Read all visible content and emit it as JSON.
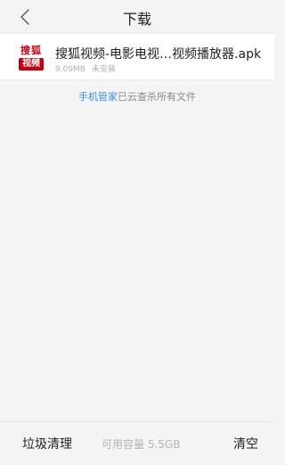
{
  "header": {
    "title": "下载",
    "back_icon": "chevron-left-icon"
  },
  "file": {
    "logo_top": "搜狐",
    "logo_bottom": "视频",
    "name": "搜狐视频-电影电视…视频播放器.apk",
    "size": "9.09MB",
    "status": "未安装"
  },
  "scan_note": {
    "highlight": "手机管家",
    "text": "已云查杀所有文件"
  },
  "footer": {
    "junk_clean_label": "垃圾清理",
    "capacity_label": "可用容量 5.5GB",
    "clear_label": "清空"
  },
  "colors": {
    "accent": "#3a8ee6",
    "logo_red": "#c40010",
    "background": "#f4f4f4"
  }
}
